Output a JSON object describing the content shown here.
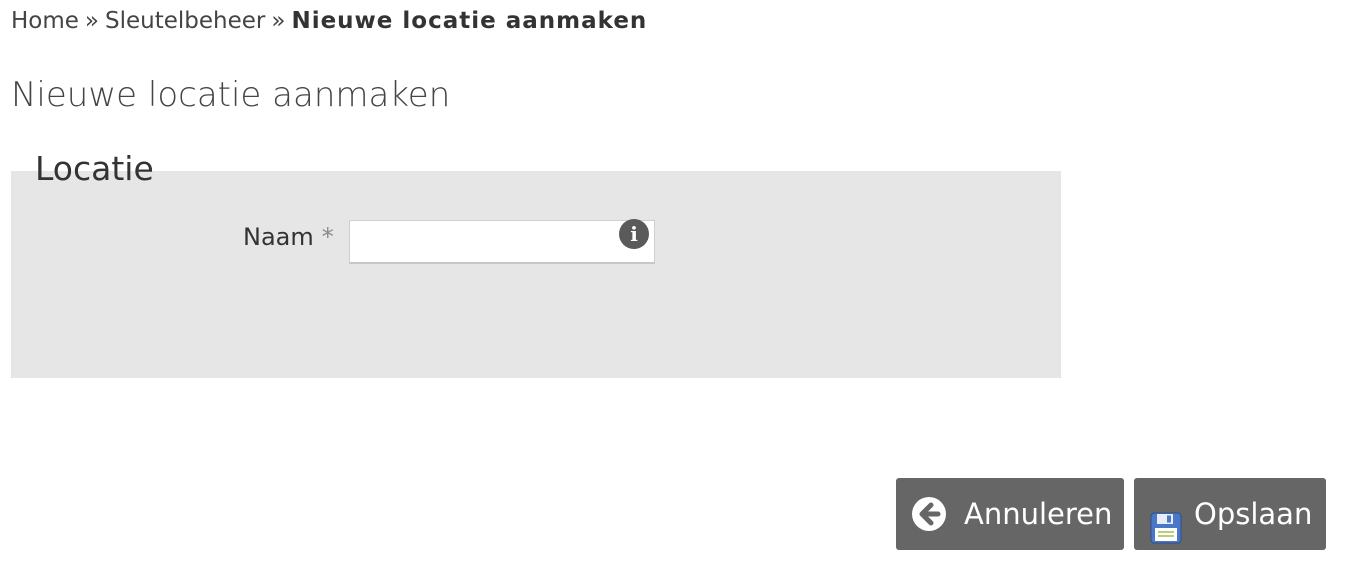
{
  "breadcrumb": {
    "home": "Home",
    "separator": "»",
    "section": "Sleutelbeheer",
    "current": "Nieuwe locatie aanmaken"
  },
  "page": {
    "title": "Nieuwe locatie aanmaken"
  },
  "form": {
    "legend": "Locatie",
    "name_label": "Naam",
    "required_marker": "*",
    "name_value": "",
    "info_glyph": "i"
  },
  "actions": {
    "cancel_label": "Annuleren",
    "save_label": "Opslaan",
    "cancel_icon": "arrow-left-circle-icon",
    "save_icon": "floppy-disk-icon"
  },
  "colors": {
    "fieldset_bg": "#e6e6e6",
    "button_bg": "#666666",
    "floppy_blue": "#4a78c8"
  }
}
